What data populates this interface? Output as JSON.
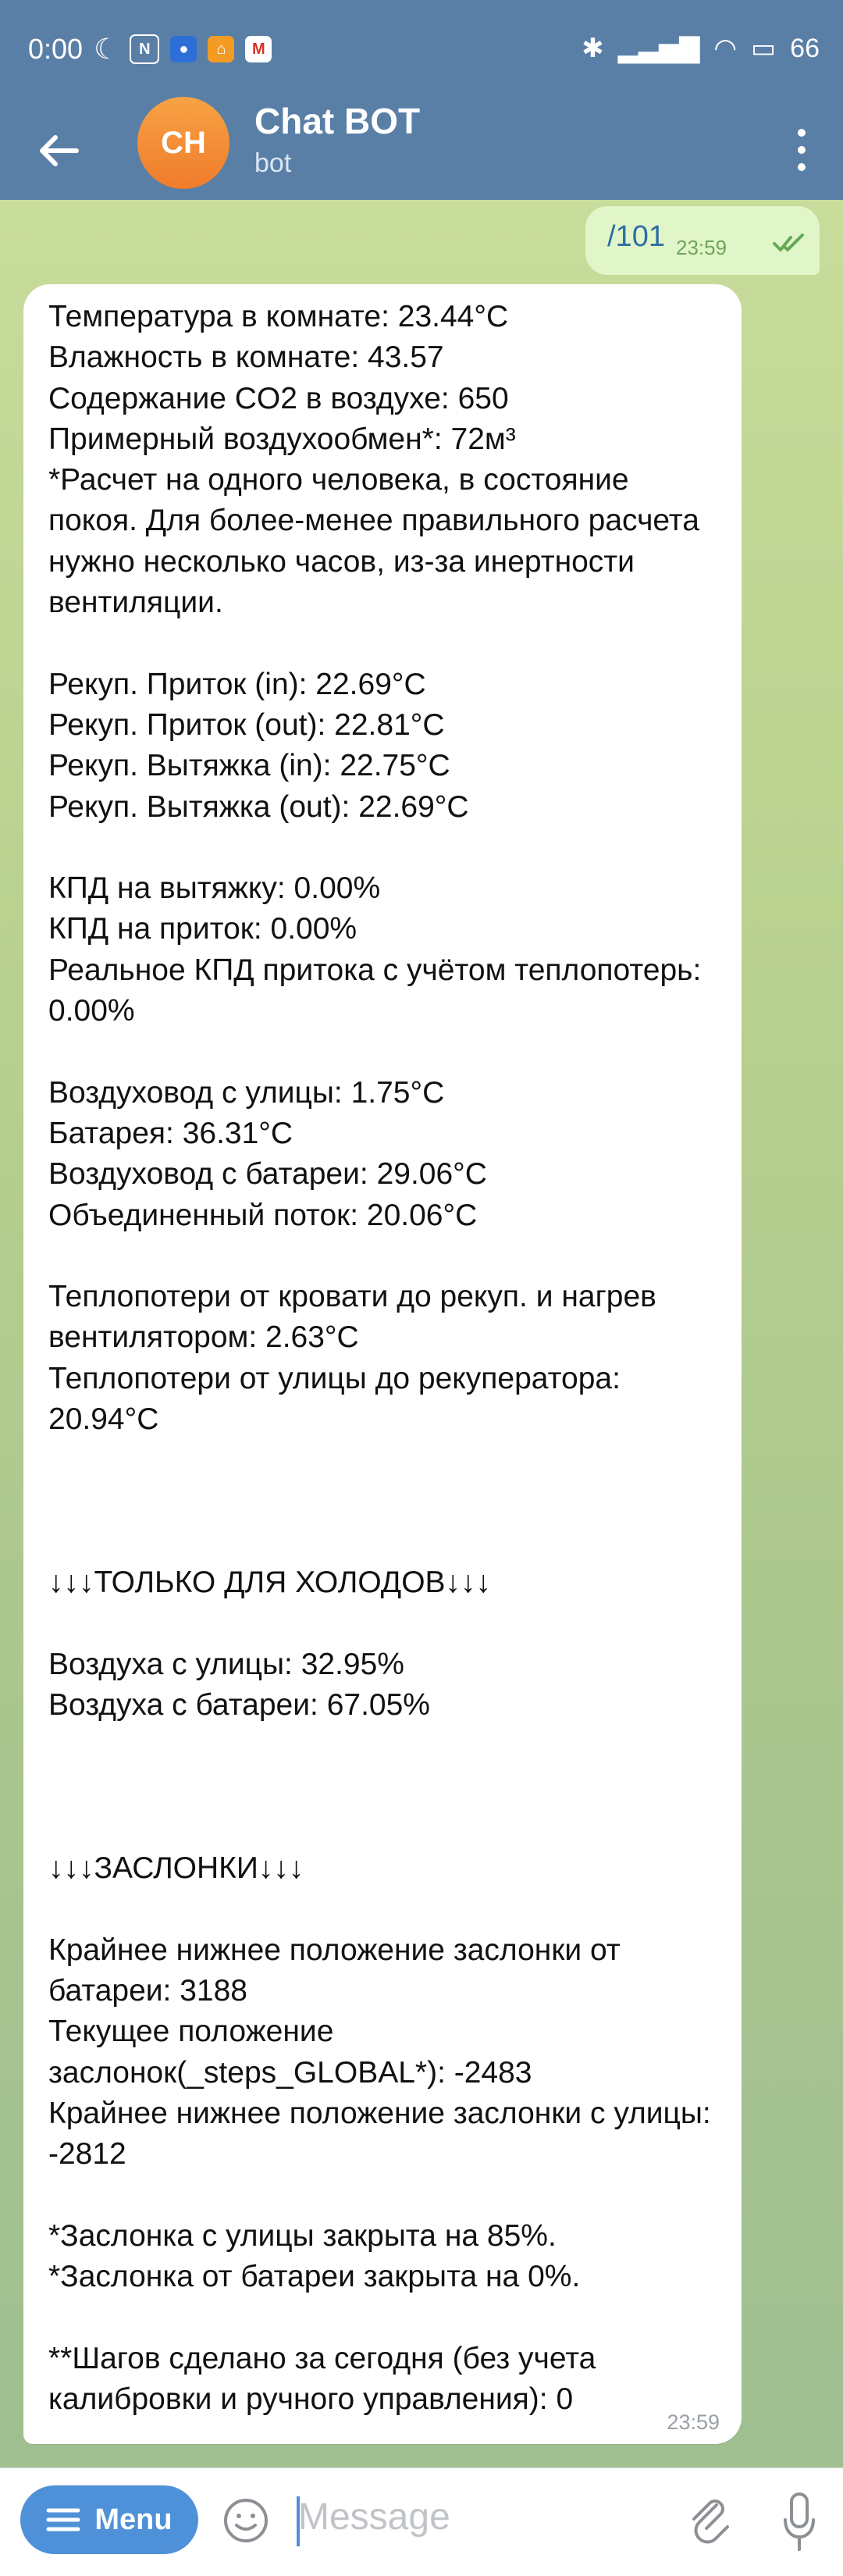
{
  "status": {
    "time": "0:00",
    "battery": "66"
  },
  "header": {
    "avatar_initials": "CH",
    "title": "Chat BOT",
    "subtitle": "bot"
  },
  "outgoing": {
    "text": "/101",
    "time": "23:59"
  },
  "incoming": {
    "time": "23:59",
    "text": "Температура в комнате: 23.44°C\nВлажность в комнате: 43.57\nСодержание CO2 в воздухе: 650\nПримерный воздухообмен*: 72м³\n*Расчет на одного человека, в состояние покоя. Для более-менее правильного расчета нужно несколько часов, из-за инертности вентиляции.\n\nРекуп. Приток (in): 22.69°C\nРекуп. Приток (out): 22.81°C\nРекуп. Вытяжка (in): 22.75°C\nРекуп. Вытяжка (out): 22.69°C\n\nКПД на вытяжку: 0.00%\nКПД на приток: 0.00%\nРеальное КПД притока с учётом теплопотерь: 0.00%\n\nВоздуховод с улицы: 1.75°C\nБатарея: 36.31°C\nВоздуховод с батареи: 29.06°C\nОбъединенный поток: 20.06°C\n\nТеплопотери от кровати до рекуп. и нагрев вентилятором: 2.63°C\nТеплопотери от улицы до рекуператора: 20.94°C\n\n\n\n↓↓↓ТОЛЬКО ДЛЯ ХОЛОДОВ↓↓↓\n\nВоздуха с улицы: 32.95%\nВоздуха с батареи: 67.05%\n\n\n\n↓↓↓ЗАСЛОНКИ↓↓↓\n\nКрайнее нижнее положение заслонки от батареи: 3188\nТекущее положение заслонок(_steps_GLOBAL*): -2483\nКрайнее нижнее положение заслонки с улицы: -2812\n\n*Заслонка с улицы закрыта на 85%.\n*Заслонка от батареи закрыта на 0%.\n\n**Шагов сделано за сегодня (без учета калибровки и ручного управления): 0"
  },
  "composer": {
    "menu_label": "Menu",
    "placeholder": "Message"
  }
}
